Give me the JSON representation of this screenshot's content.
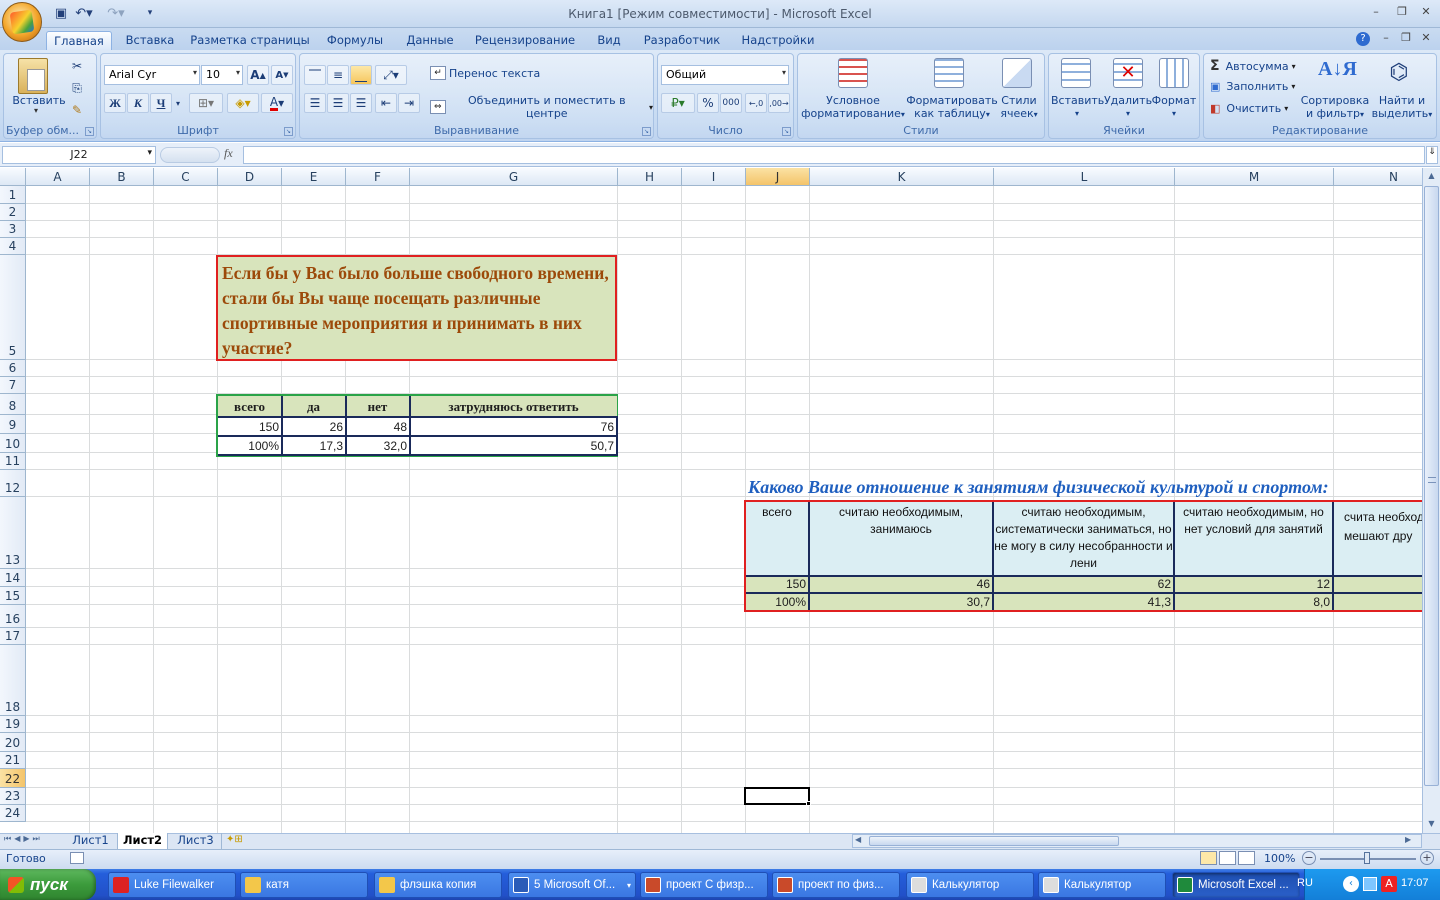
{
  "window": {
    "title": "Книга1  [Режим совместимости] - Microsoft Excel",
    "controls": [
      "–",
      "❐",
      "✕"
    ],
    "inner_controls": [
      "–",
      "❐",
      "✕"
    ]
  },
  "tabs": [
    "Главная",
    "Вставка",
    "Разметка страницы",
    "Формулы",
    "Данные",
    "Рецензирование",
    "Вид",
    "Разработчик",
    "Надстройки"
  ],
  "ribbon": {
    "clipboard": {
      "paste": "Вставить",
      "label": "Буфер обм..."
    },
    "font": {
      "name": "Arial Cyr",
      "size": "10",
      "bold": "Ж",
      "italic": "К",
      "underline": "Ч",
      "label": "Шрифт"
    },
    "alignment": {
      "wrap": "Перенос текста",
      "merge": "Объединить и поместить в центре",
      "label": "Выравнивание"
    },
    "number": {
      "format": "Общий",
      "percent": "%",
      "thousands": "000",
      "label": "Число"
    },
    "styles": {
      "conditional": [
        "Условное",
        "форматирование"
      ],
      "as_table": [
        "Форматировать",
        "как таблицу"
      ],
      "cell_styles": [
        "Стили",
        "ячеек"
      ],
      "label": "Стили"
    },
    "cells": {
      "insert": "Вставить",
      "delete": "Удалить",
      "format": "Формат",
      "label": "Ячейки"
    },
    "editing": {
      "autosum": "Автосумма",
      "fill": "Заполнить",
      "clear": "Очистить",
      "sort": [
        "Сортировка",
        "и фильтр"
      ],
      "find": [
        "Найти и",
        "выделить"
      ],
      "label": "Редактирование"
    }
  },
  "formula_bar": {
    "name_box": "J22",
    "fx": "fx",
    "value": ""
  },
  "columns": [
    "A",
    "B",
    "C",
    "D",
    "E",
    "F",
    "G",
    "H",
    "I",
    "J",
    "K",
    "L",
    "M",
    "N"
  ],
  "rows": [
    "1",
    "2",
    "3",
    "4",
    "5",
    "6",
    "7",
    "8",
    "9",
    "10",
    "11",
    "12",
    "13",
    "14",
    "15",
    "16",
    "17",
    "18",
    "19",
    "20",
    "21",
    "22",
    "23",
    "24"
  ],
  "selected": {
    "column": "J",
    "row": "22"
  },
  "question1": {
    "text": "Если бы у Вас было больше свободного времени, стали бы Вы чаще посещать различные спортивные мероприятия и принимать в них участие?",
    "headers": [
      "всего",
      "да",
      "нет",
      "затрудняюсь ответить"
    ],
    "row_counts": [
      "150",
      "26",
      "48",
      "76"
    ],
    "row_percents": [
      "100%",
      "17,3",
      "32,0",
      "50,7"
    ]
  },
  "question2": {
    "title": "Каково Ваше отношение к занятиям физической культурой и спортом:",
    "headers": [
      "всего",
      "считаю необходимым, занимаюсь",
      "считаю необходимым, систематически заниматься, но  не могу в силу несобранности и лени",
      "считаю необходимым, но нет условий для занятий",
      "счита необходим мешают дру"
    ],
    "row_counts": [
      "150",
      "46",
      "62",
      "12"
    ],
    "row_percents": [
      "100%",
      "30,7",
      "41,3",
      "8,0"
    ]
  },
  "sheets": [
    "Лист1",
    "Лист2",
    "Лист3"
  ],
  "active_sheet": "Лист2",
  "status": {
    "ready": "Готово",
    "zoom": "100%"
  },
  "taskbar": {
    "start": "пуск",
    "items": [
      "Luke Filewalker",
      "катя",
      "флэшка копия",
      "5 Microsoft Of...",
      "проект С физр...",
      "проект по физ...",
      "Калькулятор",
      "Калькулятор",
      "Microsoft Excel ..."
    ],
    "lang": "RU",
    "clock": "17:07"
  },
  "colors": {
    "q1_fill": "#d8e4bc",
    "q1_border": "#e02020",
    "q1_text": "#9c4a0a",
    "q2_title": "#1f5fbf",
    "q2_header_fill": "#dbeef3",
    "selection_header": "#f4c46a"
  }
}
